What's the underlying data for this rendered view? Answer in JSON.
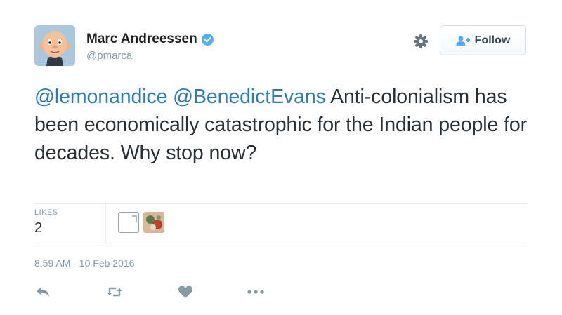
{
  "author": {
    "display_name": "Marc Andreessen",
    "handle": "@pmarca",
    "verified": true
  },
  "header_actions": {
    "settings_icon": "gear-icon",
    "follow_label": "Follow"
  },
  "tweet": {
    "mention_1": "@lemonandice",
    "mention_2": "@BenedictEvans",
    "body": "Anti-colonialism has been economically catastrophic for the Indian people for decades. Why stop now?"
  },
  "stats": {
    "likes_label": "LIKES",
    "likes_count": "2"
  },
  "timestamp": "8:59 AM - 10 Feb 2016",
  "actions": [
    "reply-icon",
    "retweet-icon",
    "like-icon",
    "more-icon"
  ],
  "colors": {
    "link": "#2b7bb9",
    "verified": "#55acee",
    "muted": "#8899a6",
    "text": "#292f33"
  }
}
